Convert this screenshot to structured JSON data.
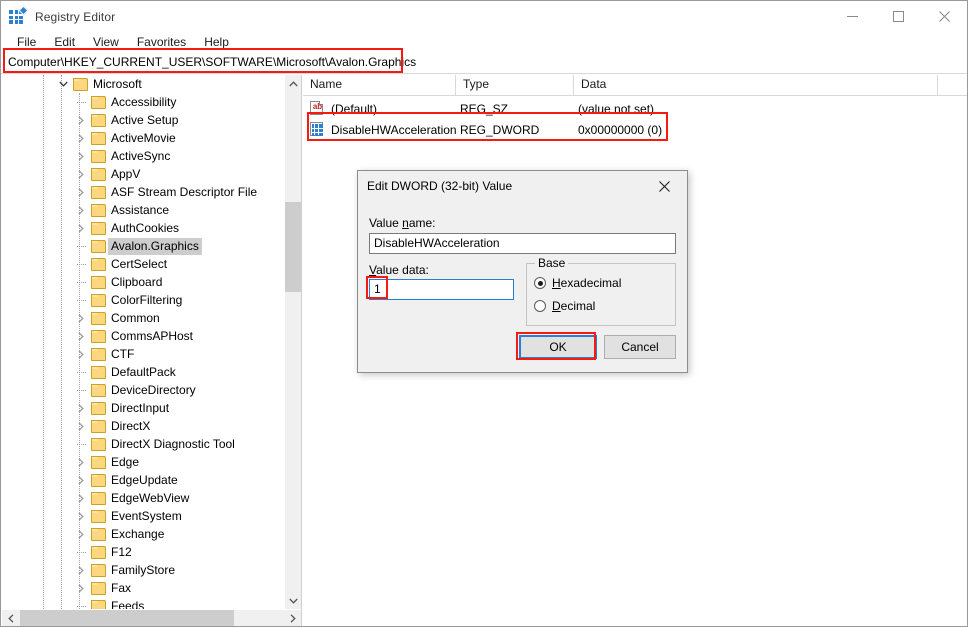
{
  "window": {
    "title": "Registry Editor",
    "icon": "registry-editor-icon",
    "controls": {
      "minimize": "minimize-icon",
      "maximize": "maximize-icon",
      "close": "close-icon"
    }
  },
  "menubar": {
    "items": [
      "File",
      "Edit",
      "View",
      "Favorites",
      "Help"
    ]
  },
  "address": {
    "path": "Computer\\HKEY_CURRENT_USER\\SOFTWARE\\Microsoft\\Avalon.Graphics"
  },
  "tree": {
    "items": [
      {
        "label": "Microsoft",
        "depth": 0,
        "state": "expanded",
        "selected": false
      },
      {
        "label": "Accessibility",
        "depth": 1,
        "state": "leaf",
        "selected": false
      },
      {
        "label": "Active Setup",
        "depth": 1,
        "state": "collapsed",
        "selected": false
      },
      {
        "label": "ActiveMovie",
        "depth": 1,
        "state": "collapsed",
        "selected": false
      },
      {
        "label": "ActiveSync",
        "depth": 1,
        "state": "collapsed",
        "selected": false
      },
      {
        "label": "AppV",
        "depth": 1,
        "state": "collapsed",
        "selected": false
      },
      {
        "label": "ASF Stream Descriptor File",
        "depth": 1,
        "state": "collapsed",
        "selected": false
      },
      {
        "label": "Assistance",
        "depth": 1,
        "state": "collapsed",
        "selected": false
      },
      {
        "label": "AuthCookies",
        "depth": 1,
        "state": "collapsed",
        "selected": false
      },
      {
        "label": "Avalon.Graphics",
        "depth": 1,
        "state": "leaf",
        "selected": true
      },
      {
        "label": "CertSelect",
        "depth": 1,
        "state": "leaf",
        "selected": false
      },
      {
        "label": "Clipboard",
        "depth": 1,
        "state": "leaf",
        "selected": false
      },
      {
        "label": "ColorFiltering",
        "depth": 1,
        "state": "leaf",
        "selected": false
      },
      {
        "label": "Common",
        "depth": 1,
        "state": "collapsed",
        "selected": false
      },
      {
        "label": "CommsAPHost",
        "depth": 1,
        "state": "collapsed",
        "selected": false
      },
      {
        "label": "CTF",
        "depth": 1,
        "state": "collapsed",
        "selected": false
      },
      {
        "label": "DefaultPack",
        "depth": 1,
        "state": "leaf",
        "selected": false
      },
      {
        "label": "DeviceDirectory",
        "depth": 1,
        "state": "leaf",
        "selected": false
      },
      {
        "label": "DirectInput",
        "depth": 1,
        "state": "collapsed",
        "selected": false
      },
      {
        "label": "DirectX",
        "depth": 1,
        "state": "collapsed",
        "selected": false
      },
      {
        "label": "DirectX Diagnostic Tool",
        "depth": 1,
        "state": "leaf",
        "selected": false
      },
      {
        "label": "Edge",
        "depth": 1,
        "state": "collapsed",
        "selected": false
      },
      {
        "label": "EdgeUpdate",
        "depth": 1,
        "state": "collapsed",
        "selected": false
      },
      {
        "label": "EdgeWebView",
        "depth": 1,
        "state": "collapsed",
        "selected": false
      },
      {
        "label": "EventSystem",
        "depth": 1,
        "state": "collapsed",
        "selected": false
      },
      {
        "label": "Exchange",
        "depth": 1,
        "state": "collapsed",
        "selected": false
      },
      {
        "label": "F12",
        "depth": 1,
        "state": "leaf",
        "selected": false
      },
      {
        "label": "FamilyStore",
        "depth": 1,
        "state": "collapsed",
        "selected": false
      },
      {
        "label": "Fax",
        "depth": 1,
        "state": "collapsed",
        "selected": false
      },
      {
        "label": "Feeds",
        "depth": 1,
        "state": "leaf",
        "selected": false
      }
    ]
  },
  "values": {
    "columns": [
      "Name",
      "Type",
      "Data"
    ],
    "rows": [
      {
        "icon": "string-value-icon",
        "name": "(Default)",
        "type": "REG_SZ",
        "data": "(value not set)"
      },
      {
        "icon": "dword-value-icon",
        "name": "DisableHWAcceleration",
        "type": "REG_DWORD",
        "data": "0x00000000 (0)"
      }
    ]
  },
  "dialog": {
    "title": "Edit DWORD (32-bit) Value",
    "close_icon": "close-icon",
    "value_name_label_pre": "Value ",
    "value_name_label_mnemonic": "n",
    "value_name_label_post": "ame:",
    "value_name": "DisableHWAcceleration",
    "value_data_label_mnemonic": "V",
    "value_data_label_post": "alue data:",
    "value_data": "1",
    "base_group_title": "Base",
    "base_options": [
      {
        "label_mnemonic": "H",
        "label_post": "exadecimal",
        "selected": true
      },
      {
        "label_mnemonic": "D",
        "label_post": "ecimal",
        "selected": false
      }
    ],
    "ok_label": "OK",
    "cancel_label": "Cancel"
  },
  "theme": {
    "annotation_color": "#f61a11",
    "accent_blue": "#2a7fd4",
    "folder_yellow": "#fcd77f",
    "selection_gray": "#cdcdcd"
  }
}
